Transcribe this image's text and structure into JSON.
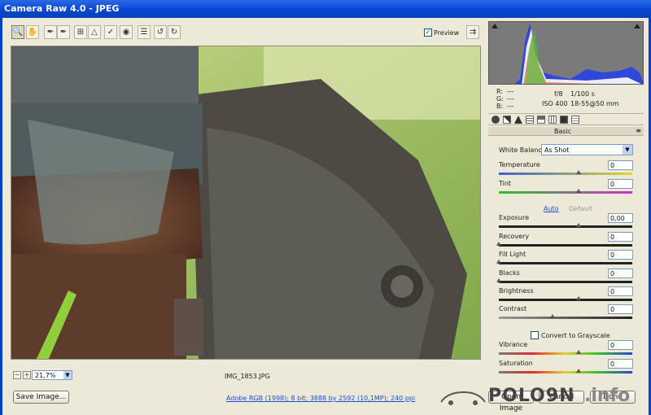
{
  "window": {
    "title": "Camera Raw 4.0  -  JPEG"
  },
  "toolbar": {
    "preview_label": "Preview",
    "preview_checked": true
  },
  "image": {
    "filename": "IMG_1853.JPG",
    "zoom": "21,7%"
  },
  "histogram_info": {
    "r_label": "R:",
    "g_label": "G:",
    "b_label": "B:",
    "r_val": "---",
    "g_val": "---",
    "b_val": "---",
    "aperture": "f/8",
    "shutter": "1/100 s",
    "iso": "ISO 400",
    "lens": "18-55@50 mm"
  },
  "panel": {
    "title": "Basic",
    "white_balance_label": "White Balance:",
    "white_balance_value": "As Shot",
    "auto_link": "Auto",
    "default_link": "Default",
    "convert_grayscale_label": "Convert to Grayscale",
    "sliders": [
      {
        "label": "Temperature",
        "value": "0",
        "level": 0.6
      },
      {
        "label": "Tint",
        "value": "0",
        "level": 0.6
      },
      {
        "label": "Exposure",
        "value": "0,00",
        "level": 0.6
      },
      {
        "label": "Recovery",
        "value": "0",
        "level": 0.0
      },
      {
        "label": "Fill Light",
        "value": "0",
        "level": 0.0
      },
      {
        "label": "Blacks",
        "value": "0",
        "level": 0.0
      },
      {
        "label": "Brightness",
        "value": "0",
        "level": 0.6
      },
      {
        "label": "Contrast",
        "value": "0",
        "level": 0.4
      },
      {
        "label": "Vibrance",
        "value": "0",
        "level": 0.6
      },
      {
        "label": "Saturation",
        "value": "0",
        "level": 0.6
      }
    ]
  },
  "bottom": {
    "save_label": "Save Image...",
    "workflow_link": "Adobe RGB (1998); 8 bit; 3888 by 2592 (10,1MP); 240 ppi",
    "open_label": "Open Image",
    "cancel_label": "Cancel",
    "done_label": "Done"
  },
  "watermark": {
    "brand": "POLO9N",
    "suffix": ".info"
  }
}
